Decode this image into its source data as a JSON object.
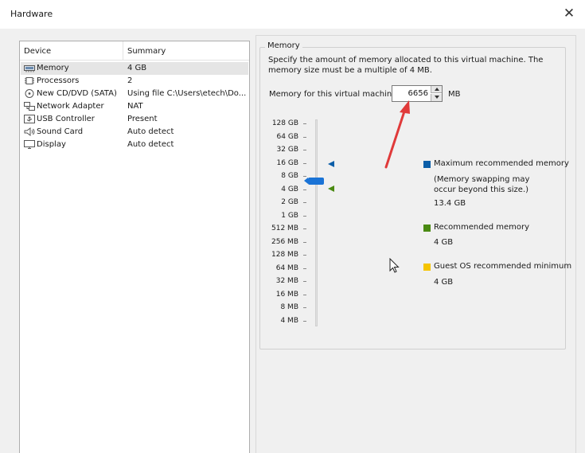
{
  "window": {
    "title": "Hardware",
    "close_glyph": "✕"
  },
  "device_table": {
    "col_device": "Device",
    "col_summary": "Summary",
    "rows": [
      {
        "icon": "memory-icon",
        "name": "Memory",
        "summary": "4 GB"
      },
      {
        "icon": "processor-icon",
        "name": "Processors",
        "summary": "2"
      },
      {
        "icon": "cd-dvd-icon",
        "name": "New CD/DVD (SATA)",
        "summary": "Using file C:\\Users\\etech\\Do..."
      },
      {
        "icon": "network-adapter-icon",
        "name": "Network Adapter",
        "summary": "NAT"
      },
      {
        "icon": "usb-icon",
        "name": "USB Controller",
        "summary": "Present"
      },
      {
        "icon": "sound-card-icon",
        "name": "Sound Card",
        "summary": "Auto detect"
      },
      {
        "icon": "display-icon",
        "name": "Display",
        "summary": "Auto detect"
      }
    ],
    "selected_index": 0
  },
  "memory": {
    "group_title": "Memory",
    "description": "Specify the amount of memory allocated to this virtual machine. The memory size must be a multiple of 4 MB.",
    "field_label": "Memory for this virtual machine:",
    "value": "6656",
    "unit": "MB",
    "scale": [
      "128 GB",
      "64 GB",
      "32 GB",
      "16 GB",
      "8 GB",
      "4 GB",
      "2 GB",
      "1 GB",
      "512 MB",
      "256 MB",
      "128 MB",
      "64 MB",
      "32 MB",
      "16 MB",
      "8 MB",
      "4 MB"
    ],
    "legend": {
      "max": {
        "label": "Maximum recommended memory",
        "note_1": "(Memory swapping may",
        "note_2": "occur beyond this size.)",
        "value": "13.4 GB",
        "color": "#0b5ea8"
      },
      "recommended": {
        "label": "Recommended memory",
        "value": "4 GB",
        "color": "#4a8a12"
      },
      "guest_min": {
        "label": "Guest OS recommended minimum",
        "value": "4 GB",
        "color": "#f5c400"
      }
    },
    "thumb_color": "#1a73d6"
  },
  "annotation": {
    "arrow_color": "#e03a3a"
  }
}
